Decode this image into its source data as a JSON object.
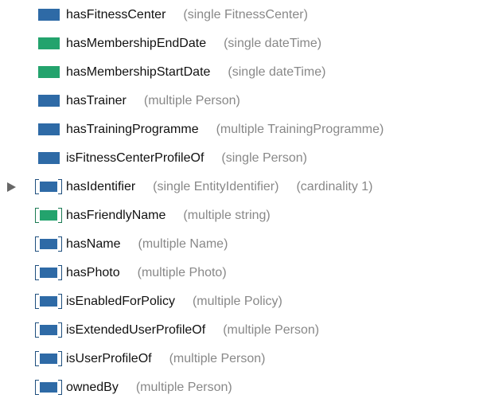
{
  "colors": {
    "object_property": "#2e6aa6",
    "datatype_property": "#23a36d",
    "secondary_text": "#888888",
    "expander": "#666666"
  },
  "properties": [
    {
      "name": "hasFitnessCenter",
      "type": "(single FitnessCenter)",
      "kind": "object",
      "inherited": false
    },
    {
      "name": "hasMembershipEndDate",
      "type": "(single dateTime)",
      "kind": "datatype",
      "inherited": false
    },
    {
      "name": "hasMembershipStartDate",
      "type": "(single dateTime)",
      "kind": "datatype",
      "inherited": false
    },
    {
      "name": "hasTrainer",
      "type": "(multiple Person)",
      "kind": "object",
      "inherited": false
    },
    {
      "name": "hasTrainingProgramme",
      "type": "(multiple TrainingProgramme)",
      "kind": "object",
      "inherited": false
    },
    {
      "name": "isFitnessCenterProfileOf",
      "type": "(single Person)",
      "kind": "object",
      "inherited": false
    },
    {
      "name": "hasIdentifier",
      "type": "(single EntityIdentifier)",
      "cardinality": "(cardinality 1)",
      "kind": "object",
      "inherited": true,
      "expander": "collapsed"
    },
    {
      "name": "hasFriendlyName",
      "type": "(multiple string)",
      "kind": "datatype",
      "inherited": true
    },
    {
      "name": "hasName",
      "type": "(multiple Name)",
      "kind": "object",
      "inherited": true
    },
    {
      "name": "hasPhoto",
      "type": "(multiple Photo)",
      "kind": "object",
      "inherited": true
    },
    {
      "name": "isEnabledForPolicy",
      "type": "(multiple Policy)",
      "kind": "object",
      "inherited": true
    },
    {
      "name": "isExtendedUserProfileOf",
      "type": "(multiple Person)",
      "kind": "object",
      "inherited": true
    },
    {
      "name": "isUserProfileOf",
      "type": "(multiple Person)",
      "kind": "object",
      "inherited": true
    },
    {
      "name": "ownedBy",
      "type": "(multiple Person)",
      "kind": "object",
      "inherited": true
    }
  ]
}
